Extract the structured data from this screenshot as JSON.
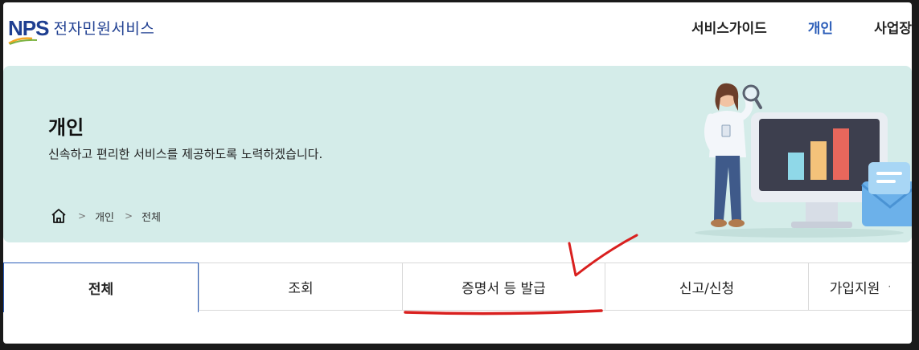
{
  "header": {
    "logo_mark": "NPS",
    "logo_text": "전자민원서비스",
    "nav": [
      {
        "label": "서비스가이드",
        "active": false
      },
      {
        "label": "개인",
        "active": true
      },
      {
        "label": "사업장",
        "active": false
      }
    ]
  },
  "banner": {
    "title": "개인",
    "description": "신속하고 편리한 서비스를 제공하도록 노력하겠습니다.",
    "breadcrumb": [
      "개인",
      "전체"
    ],
    "home_icon": "home-icon",
    "illustration": "woman-with-magnifier-and-chart-monitor"
  },
  "tabs": [
    {
      "label": "전체",
      "active": true
    },
    {
      "label": "조회",
      "active": false
    },
    {
      "label": "증명서 등 발급",
      "active": false,
      "highlighted": true
    },
    {
      "label": "신고/신청",
      "active": false
    },
    {
      "label": "가입지원",
      "active": false
    }
  ],
  "colors": {
    "brand": "#1f3f91",
    "active_nav": "#2a5cb8",
    "banner_bg": "#d4ece9",
    "annotation": "#d9201f"
  }
}
